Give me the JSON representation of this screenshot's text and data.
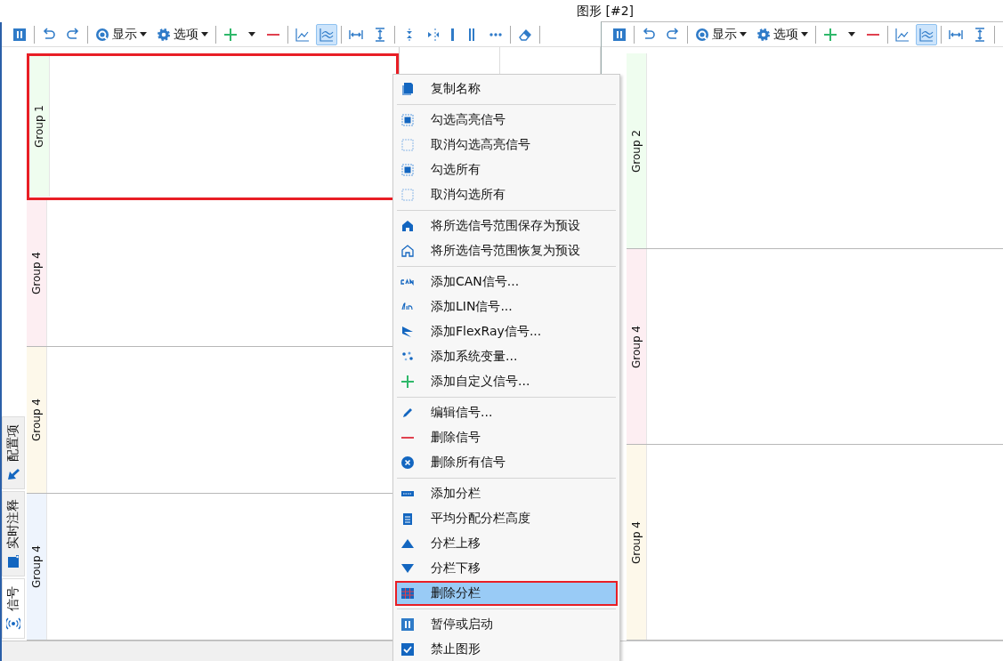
{
  "title": "图形 [#2]",
  "left_window": {
    "toolbar": [
      [
        {
          "selected": false
        }
      ],
      [
        {
          "selected": false
        },
        {
          "selected": false
        }
      ],
      [
        {
          "label": "显示"
        },
        {
          "label": "选项"
        }
      ],
      [
        {
          "selected": false
        },
        {
          "selected": false
        },
        {
          "selected": false
        }
      ],
      [
        {
          "selected": false
        },
        {
          "selected": true
        }
      ],
      [
        {
          "selected": false
        },
        {
          "selected": false
        }
      ],
      [
        {
          "selected": false
        },
        {
          "selected": false
        },
        {
          "selected": false
        },
        {
          "selected": false
        },
        {
          "selected": false
        }
      ],
      [
        {
          "selected": false
        }
      ]
    ],
    "side_tabs": [
      {
        "label": "配置项",
        "selected": false
      },
      {
        "label": "实时注释",
        "selected": false
      },
      {
        "label": "信号",
        "selected": true
      }
    ],
    "panels": [
      {
        "label": "Group 1",
        "color": "#effdef",
        "highlighted": true
      },
      {
        "label": "Group 4",
        "color": "#fdeef2",
        "highlighted": false
      },
      {
        "label": "Group 4",
        "color": "#fdf8ea",
        "highlighted": false
      },
      {
        "label": "Group 4",
        "color": "#eef4fd",
        "highlighted": false
      }
    ]
  },
  "right_window": {
    "toolbar": [
      [
        {
          "selected": false
        }
      ],
      [
        {
          "selected": false
        },
        {
          "selected": false
        }
      ],
      [
        {
          "label": "显示"
        },
        {
          "label": "选项"
        }
      ],
      [
        {
          "selected": false
        },
        {
          "selected": false
        },
        {
          "selected": false
        }
      ],
      [
        {
          "selected": false
        },
        {
          "selected": true
        }
      ],
      [
        {
          "selected": false
        },
        {
          "selected": false
        }
      ]
    ],
    "panels": [
      {
        "label": "Group 2",
        "color": "#effdef",
        "highlighted": false
      },
      {
        "label": "Group 4",
        "color": "#fdeef2",
        "highlighted": false
      },
      {
        "label": "Group 4",
        "color": "#fdf8ea",
        "highlighted": false
      }
    ]
  },
  "context_menu": {
    "sections": [
      [
        {
          "label": "复制名称",
          "selected": false
        }
      ],
      [
        {
          "label": "勾选高亮信号",
          "selected": false
        },
        {
          "label": "取消勾选高亮信号",
          "selected": false
        },
        {
          "label": "勾选所有",
          "selected": false
        },
        {
          "label": "取消勾选所有",
          "selected": false
        }
      ],
      [
        {
          "label": "将所选信号范围保存为预设",
          "selected": false
        },
        {
          "label": "将所选信号范围恢复为预设",
          "selected": false
        }
      ],
      [
        {
          "label": "添加CAN信号...",
          "selected": false
        },
        {
          "label": "添加LIN信号...",
          "selected": false
        },
        {
          "label": "添加FlexRay信号...",
          "selected": false
        },
        {
          "label": "添加系统变量...",
          "selected": false
        },
        {
          "label": "添加自定义信号...",
          "selected": false
        }
      ],
      [
        {
          "label": "编辑信号...",
          "selected": false
        },
        {
          "label": "删除信号",
          "selected": false
        },
        {
          "label": "删除所有信号",
          "selected": false
        }
      ],
      [
        {
          "label": "添加分栏",
          "selected": false
        },
        {
          "label": "平均分配分栏高度",
          "selected": false
        },
        {
          "label": "分栏上移",
          "selected": false
        },
        {
          "label": "分栏下移",
          "selected": false
        },
        {
          "label": "删除分栏",
          "selected": true
        }
      ],
      [
        {
          "label": "暂停或启动",
          "selected": false
        },
        {
          "label": "禁止图形",
          "selected": false
        }
      ]
    ]
  }
}
